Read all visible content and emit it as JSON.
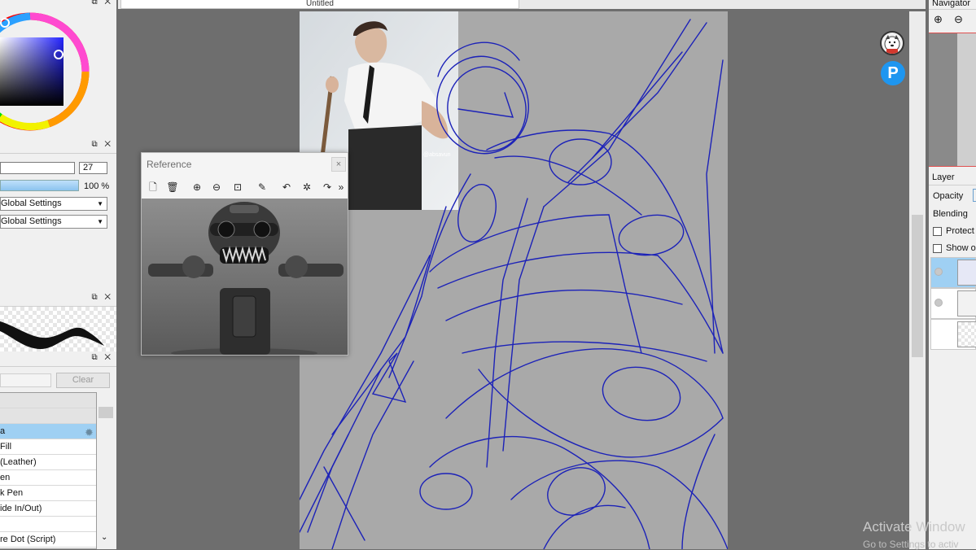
{
  "document": {
    "tab_title": "Untitled"
  },
  "left": {
    "size_value": "27",
    "density_percent": "100 %",
    "density_level": 1.0,
    "blend_combo_1": "Global Settings",
    "blend_combo_2": "Global Settings",
    "clear_label": "Clear",
    "brush_items": [
      "",
      "",
      "a",
      "Fill",
      "(Leather)",
      "en",
      "k Pen",
      "ide In/Out)",
      "",
      "re Dot (Script)"
    ]
  },
  "reference": {
    "title": "Reference",
    "close": "×",
    "more": "»",
    "photo_watermark": "@absavun"
  },
  "navigator": {
    "title": "Navigator"
  },
  "layer": {
    "title": "Layer",
    "opacity_label": "Opacity",
    "blending_label": "Blending",
    "protect_label": "Protect A",
    "show_label": "Show or"
  },
  "colors": {
    "sketch_stroke": "#1c22b8",
    "selected_row": "#9fd0f3",
    "canvas": "#a9a9a9",
    "workspace": "#6e6e6e",
    "pixiv_blue": "#1e96f0"
  },
  "windows_watermark": {
    "line1": "Activate Window",
    "line2": "Go to Settings to activ"
  }
}
